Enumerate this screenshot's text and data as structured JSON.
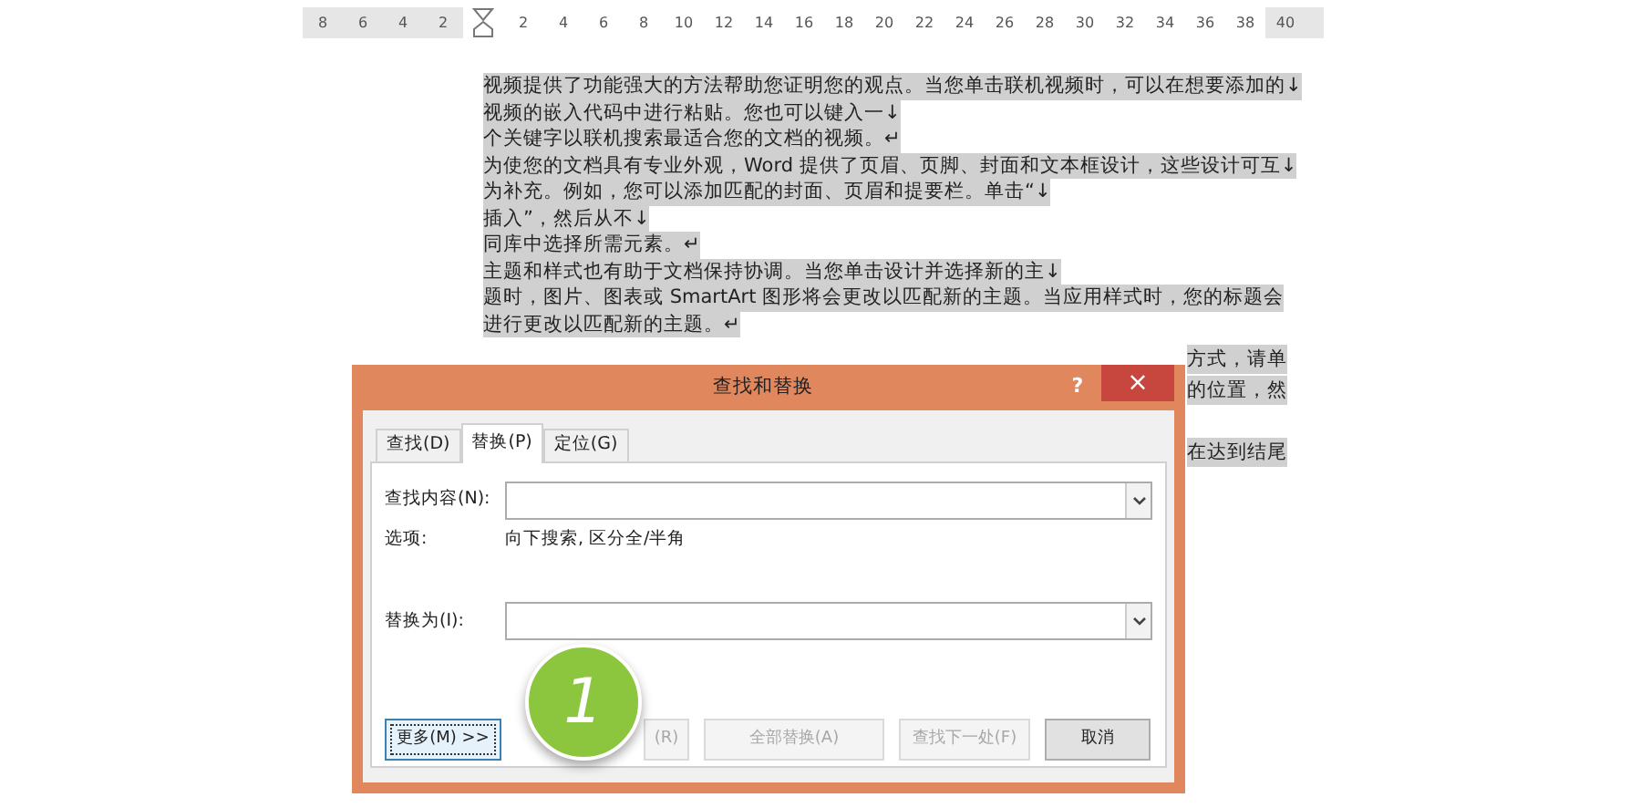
{
  "ruler": {
    "left_ticks": [
      "8",
      "6",
      "4",
      "2"
    ],
    "ticks": [
      "2",
      "4",
      "6",
      "8",
      "10",
      "12",
      "14",
      "16",
      "18",
      "20",
      "22",
      "24",
      "26",
      "28",
      "30",
      "32",
      "34",
      "36",
      "38",
      "40"
    ]
  },
  "document": {
    "lines": [
      {
        "text": "视频提供了功能强大的方法帮助您证明您的观点。当您单击联机视频时，可以在想要添加的↓",
        "selected": true
      },
      {
        "text": "视频的嵌入代码中进行粘贴。您也可以键入一↓",
        "selected": true
      },
      {
        "text": "个关键字以联机搜索最适合您的文档的视频。↵",
        "selected": true
      },
      {
        "text": "为使您的文档具有专业外观，Word 提供了页眉、页脚、封面和文本框设计，这些设计可互↓",
        "selected": true
      },
      {
        "text": "为补充。例如，您可以添加匹配的封面、页眉和提要栏。单击“↓",
        "selected": true
      },
      {
        "text": "插入”，然后从不↓",
        "selected": true
      },
      {
        "text": "同库中选择所需元素。↵",
        "selected": true
      },
      {
        "text": "主题和样式也有助于文档保持协调。当您单击设计并选择新的主↓",
        "selected": true
      },
      {
        "text": "题时，图片、图表或 SmartArt 图形将会更改以匹配新的主题。当应用样式时，您的标题会",
        "selected": true
      },
      {
        "text": "进行更改以匹配新的主题。↵",
        "selected": true
      }
    ],
    "fragments": [
      {
        "text": "方式，请单",
        "selected": true
      },
      {
        "text": "的位置，然",
        "selected": true
      },
      {
        "text": "在达到结尾",
        "selected": true
      }
    ]
  },
  "dialog": {
    "title": "查找和替换",
    "help": "?",
    "close": "×",
    "tabs": [
      {
        "label": "查找(D)",
        "selected": false
      },
      {
        "label": "替换(P)",
        "selected": true
      },
      {
        "label": "定位(G)",
        "selected": false
      }
    ],
    "find_label": "查找内容(N):",
    "options_label": "选项:",
    "options_value": "向下搜索, 区分全/半角",
    "replace_label": "替换为(I):",
    "buttons": [
      {
        "label": "更多(M) >>",
        "kind": "focused"
      },
      {
        "label": "(R)",
        "kind": "disabled"
      },
      {
        "label": "全部替换(A)",
        "kind": "disabled"
      },
      {
        "label": "查找下一处(F)",
        "kind": "disabled"
      },
      {
        "label": "取消",
        "kind": "normal"
      }
    ],
    "badge": "1"
  }
}
